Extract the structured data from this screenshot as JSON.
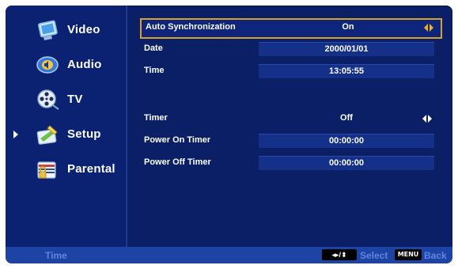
{
  "sidebar": {
    "items": [
      {
        "label": "Video",
        "icon": "video-monitor-icon",
        "selected": false
      },
      {
        "label": "Audio",
        "icon": "speaker-icon",
        "selected": false
      },
      {
        "label": "TV",
        "icon": "film-reel-icon",
        "selected": false
      },
      {
        "label": "Setup",
        "icon": "setup-tools-icon",
        "selected": true
      },
      {
        "label": "Parental",
        "icon": "parental-lock-icon",
        "selected": false
      }
    ]
  },
  "settings": {
    "rows": [
      {
        "label": "Auto Synchronization",
        "value": "On",
        "type": "toggle",
        "focused": true
      },
      {
        "label": "Date",
        "value": "2000/01/01",
        "type": "field"
      },
      {
        "label": "Time",
        "value": "13:05:55",
        "type": "field"
      },
      {
        "label": "Timer",
        "value": "Off",
        "type": "toggle"
      },
      {
        "label": "Power On Timer",
        "value": "00:00:00",
        "type": "field"
      },
      {
        "label": "Power Off Timer",
        "value": "00:00:00",
        "type": "field"
      }
    ]
  },
  "bottom_bar": {
    "status": "Time",
    "nav_key": "◂▸/⬍",
    "select_label": "Select",
    "menu_key": "MENU",
    "back_label": "Back"
  },
  "colors": {
    "background": "#0a1f66",
    "focus_border": "#d4a32c",
    "hint_text": "#5c86e0"
  }
}
